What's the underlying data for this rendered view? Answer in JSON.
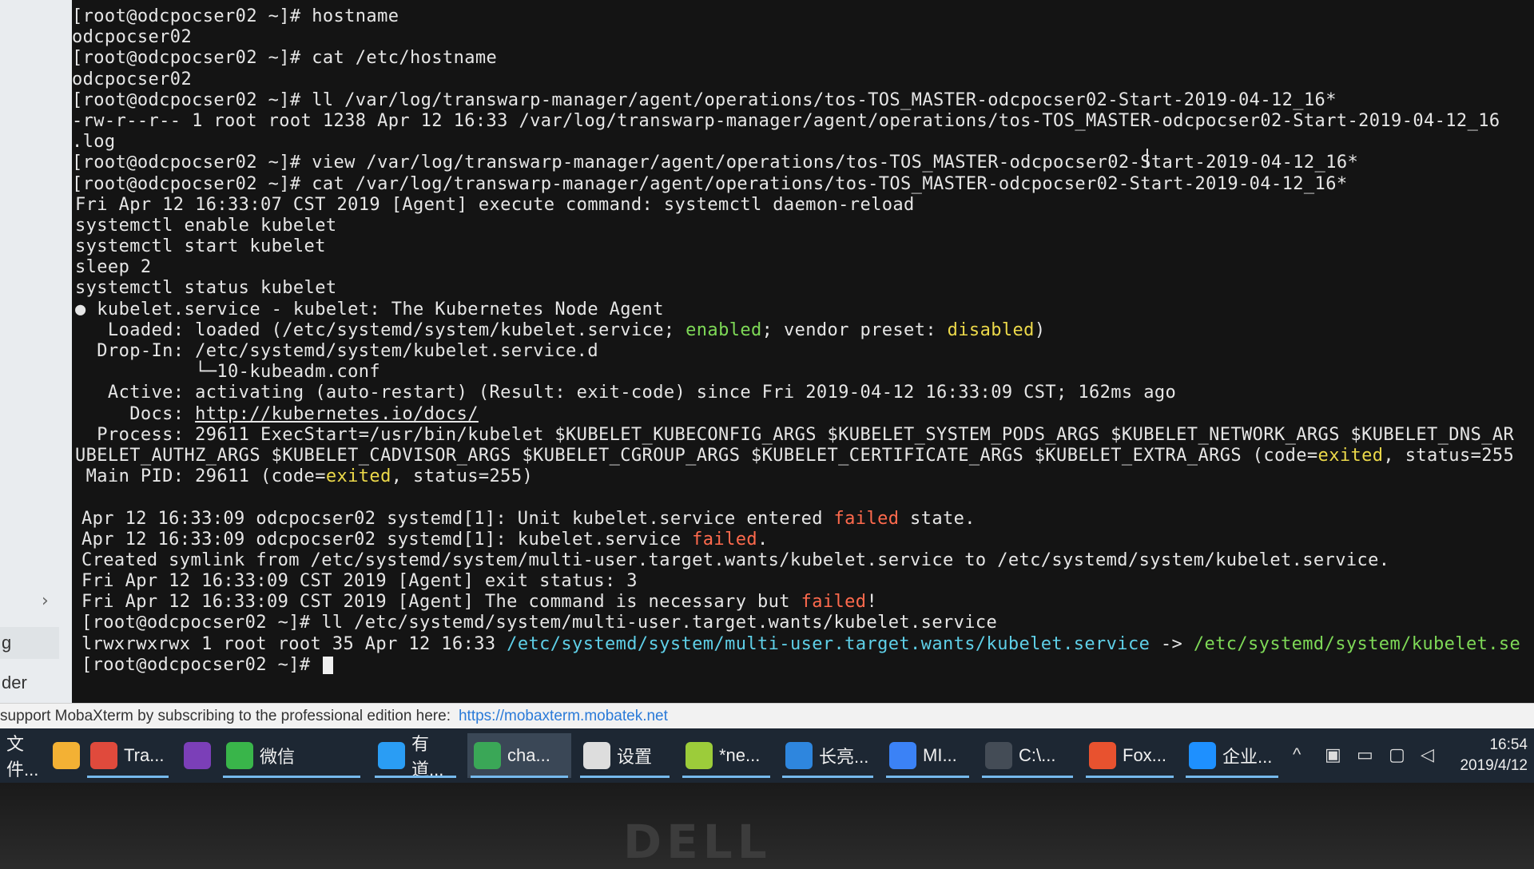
{
  "terminal": {
    "lines": [
      {
        "segments": [
          {
            "t": "[root@odcpocser02 ~]# hostname"
          }
        ]
      },
      {
        "segments": [
          {
            "t": "odcpocser02"
          }
        ]
      },
      {
        "segments": [
          {
            "t": "[root@odcpocser02 ~]# cat /etc/hostname"
          }
        ]
      },
      {
        "segments": [
          {
            "t": "odcpocser02"
          }
        ]
      },
      {
        "segments": [
          {
            "t": "[root@odcpocser02 ~]# ll /var/log/transwarp-manager/agent/operations/tos-TOS_MASTER-odcpocser02-Start-2019-04-12_16*"
          }
        ]
      },
      {
        "segments": [
          {
            "t": "-rw-r--r-- 1 root root 1238 Apr 12 16:33 /var/log/transwarp-manager/agent/operations/tos-TOS_MASTER-odcpocser02-Start-2019-04-12_16"
          }
        ]
      },
      {
        "segments": [
          {
            "t": ".log"
          }
        ]
      },
      {
        "segments": [
          {
            "t": "[root@odcpocser02 ~]# view /var/log/transwarp-manager/agent/operations/tos-TOS_MASTER-odcpocser02-Start-2019-04-12_16*"
          }
        ]
      },
      {
        "segments": [
          {
            "t": "[root@odcpocser02 ~]# cat /var/log/transwarp-manager/agent/operations/tos-TOS_MASTER-odcpocser02-Start-2019-04-12_16*"
          }
        ]
      },
      {
        "segments": [
          {
            "t": "Fri Apr 12 16:33:07 CST 2019 [Agent] execute command: systemctl daemon-reload"
          }
        ]
      },
      {
        "segments": [
          {
            "t": "systemctl enable kubelet"
          }
        ]
      },
      {
        "segments": [
          {
            "t": "systemctl start kubelet"
          }
        ]
      },
      {
        "segments": [
          {
            "t": "sleep 2"
          }
        ]
      },
      {
        "segments": [
          {
            "t": "systemctl status kubelet"
          }
        ]
      },
      {
        "segments": [
          {
            "t": "● kubelet.service - kubelet: The Kubernetes Node Agent"
          }
        ]
      },
      {
        "segments": [
          {
            "t": "   Loaded: loaded (/etc/systemd/system/kubelet.service; "
          },
          {
            "t": "enabled",
            "c": "green"
          },
          {
            "t": "; vendor preset: "
          },
          {
            "t": "disabled",
            "c": "yellow"
          },
          {
            "t": ")"
          }
        ]
      },
      {
        "segments": [
          {
            "t": "  Drop-In: /etc/systemd/system/kubelet.service.d"
          }
        ]
      },
      {
        "segments": [
          {
            "t": "           └─10-kubeadm.conf"
          }
        ]
      },
      {
        "segments": [
          {
            "t": "   Active: activating (auto-restart) (Result: exit-code) since Fri 2019-04-12 16:33:09 CST; 162ms ago"
          }
        ]
      },
      {
        "segments": [
          {
            "t": "     Docs: "
          },
          {
            "t": "http://kubernetes.io/docs/",
            "c": "link"
          }
        ]
      },
      {
        "segments": [
          {
            "t": "  Process: 29611 ExecStart=/usr/bin/kubelet $KUBELET_KUBECONFIG_ARGS $KUBELET_SYSTEM_PODS_ARGS $KUBELET_NETWORK_ARGS $KUBELET_DNS_AR"
          }
        ]
      },
      {
        "segments": [
          {
            "t": "UBELET_AUTHZ_ARGS $KUBELET_CADVISOR_ARGS $KUBELET_CGROUP_ARGS $KUBELET_CERTIFICATE_ARGS $KUBELET_EXTRA_ARGS (code="
          },
          {
            "t": "exited",
            "c": "yellow"
          },
          {
            "t": ", status=255"
          }
        ]
      },
      {
        "segments": [
          {
            "t": " Main PID: 29611 (code="
          },
          {
            "t": "exited",
            "c": "yellow"
          },
          {
            "t": ", status=255)"
          }
        ]
      },
      {
        "segments": [
          {
            "t": ""
          }
        ]
      },
      {
        "segments": [
          {
            "t": "Apr 12 16:33:09 odcpocser02 systemd[1]: Unit kubelet.service entered "
          },
          {
            "t": "failed",
            "c": "red"
          },
          {
            "t": " state."
          }
        ]
      },
      {
        "segments": [
          {
            "t": "Apr 12 16:33:09 odcpocser02 systemd[1]: kubelet.service "
          },
          {
            "t": "failed",
            "c": "red"
          },
          {
            "t": "."
          }
        ]
      },
      {
        "segments": [
          {
            "t": "Created symlink from /etc/systemd/system/multi-user.target.wants/kubelet.service to /etc/systemd/system/kubelet.service."
          }
        ]
      },
      {
        "segments": [
          {
            "t": "Fri Apr 12 16:33:09 CST 2019 [Agent] exit status: 3"
          }
        ]
      },
      {
        "segments": [
          {
            "t": "Fri Apr 12 16:33:09 CST 2019 [Agent] The command is necessary but "
          },
          {
            "t": "failed",
            "c": "red"
          },
          {
            "t": "!"
          }
        ]
      },
      {
        "segments": [
          {
            "t": "[root@odcpocser02 ~]# ll /etc/systemd/system/multi-user.target.wants/kubelet.service"
          }
        ]
      },
      {
        "segments": [
          {
            "t": "lrwxrwxrwx 1 root root 35 Apr 12 16:33 "
          },
          {
            "t": "/etc/systemd/system/multi-user.target.wants/kubelet.service",
            "c": "cyan"
          },
          {
            "t": " -> "
          },
          {
            "t": "/etc/systemd/system/kubelet.se",
            "c": "green"
          }
        ]
      },
      {
        "segments": [
          {
            "t": "[root@odcpocser02 ~]# "
          }
        ],
        "cursor": true
      }
    ]
  },
  "sidebar": {
    "chevron": "›",
    "tab_g": "g",
    "tab_der": "der"
  },
  "statusbar": {
    "text": "support MobaXterm by subscribing to the professional edition here:",
    "link": "https://mobaxterm.mobatek.net"
  },
  "taskbar": {
    "items": [
      {
        "label": "文件...",
        "icon": "folder-icon",
        "color": "#e8c56a"
      },
      {
        "label": "",
        "icon": "store-icon",
        "color": "#f3b134"
      },
      {
        "label": "Tra...",
        "icon": "chrome-icon",
        "color": "#e04a3c"
      },
      {
        "label": "",
        "icon": "onenote-icon",
        "color": "#7b3fb8"
      },
      {
        "label": "微信",
        "icon": "wechat-icon",
        "color": "#39b54a"
      },
      {
        "label": "有道...",
        "icon": "youdao-icon",
        "color": "#2a9df4"
      },
      {
        "label": "cha...",
        "icon": "chart-app-icon",
        "color": "#3aa757"
      },
      {
        "label": "设置",
        "icon": "gear-icon",
        "color": "#dddddd"
      },
      {
        "label": "*ne...",
        "icon": "notepad-icon",
        "color": "#9ccc3a"
      },
      {
        "label": "长亮...",
        "icon": "app-icon",
        "color": "#2e86de"
      },
      {
        "label": "MI...",
        "icon": "mi-icon",
        "color": "#3b82f6"
      },
      {
        "label": "C:\\...",
        "icon": "cmd-icon",
        "color": "#444c56"
      },
      {
        "label": "Fox...",
        "icon": "foxit-icon",
        "color": "#e8522f"
      },
      {
        "label": "企业...",
        "icon": "enterprise-icon",
        "color": "#1e90ff"
      }
    ],
    "tray_icons": [
      "chevron-up-icon",
      "cube-icon",
      "battery-icon",
      "network-icon",
      "volume-icon"
    ],
    "time": "16:54",
    "date": "2019/4/12"
  },
  "monitor": {
    "brand": "DELL"
  }
}
